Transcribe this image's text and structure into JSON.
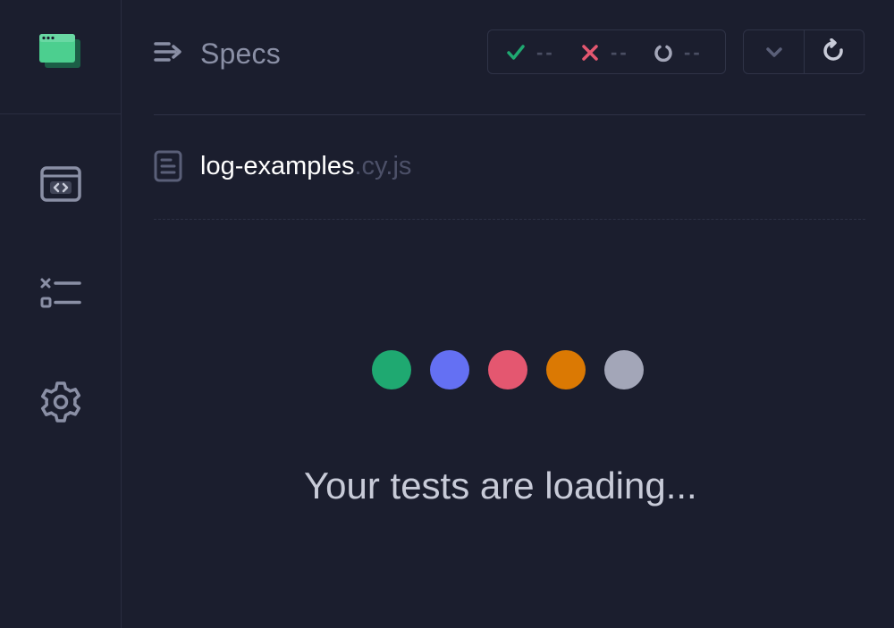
{
  "header": {
    "title": "Specs",
    "stats": {
      "passed": "--",
      "failed": "--",
      "pending": "--"
    }
  },
  "spec": {
    "name": "log-examples",
    "extension": ".cy.js"
  },
  "loading": {
    "message": "Your tests are loading...",
    "dot_colors": [
      "#1fa971",
      "#6470f3",
      "#e45770",
      "#db7903",
      "#a3a6b8"
    ]
  },
  "colors": {
    "background": "#1b1e2e",
    "pass": "#1fa971",
    "fail": "#e45770",
    "pending": "#a3a6b8",
    "logo": "#4ccf8f"
  },
  "icons": {
    "sidebar": [
      "app-logo-icon",
      "browser-code-icon",
      "test-list-icon",
      "gear-icon"
    ],
    "header": [
      "specs-list-icon",
      "check-icon",
      "x-icon",
      "spinner-icon",
      "chevron-down-icon",
      "refresh-icon"
    ],
    "spec": "document-icon"
  }
}
